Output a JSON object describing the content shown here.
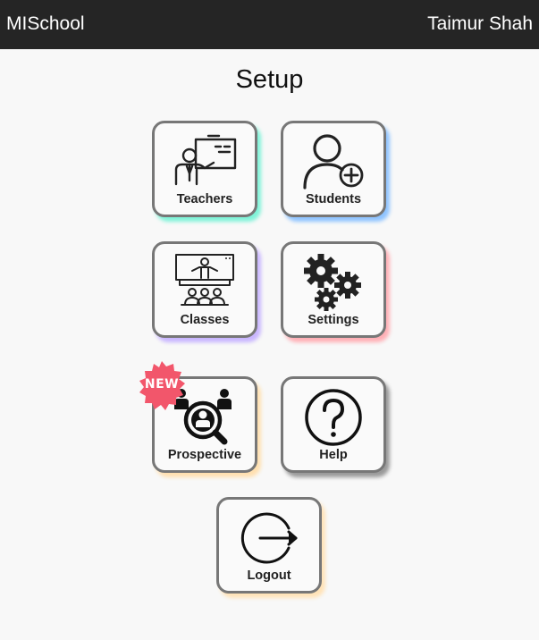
{
  "header": {
    "brand": "MISchool",
    "user": "Taimur Shah"
  },
  "page": {
    "title": "Setup"
  },
  "tiles": {
    "teachers": {
      "label": "Teachers",
      "icon": "teacher-icon",
      "shadow": "#7ff3d8"
    },
    "students": {
      "label": "Students",
      "icon": "add-user-icon",
      "shadow": "#8fc4ff"
    },
    "classes": {
      "label": "Classes",
      "icon": "classroom-icon",
      "shadow": "#c9b6ff"
    },
    "settings": {
      "label": "Settings",
      "icon": "gears-icon",
      "shadow": "#ffb0b6"
    },
    "prospective": {
      "label": "Prospective",
      "icon": "prospect-search-icon",
      "shadow": "#ffe0b0",
      "badge": "NEW",
      "badge_color": "#f2566b"
    },
    "help": {
      "label": "Help",
      "icon": "help-icon",
      "shadow": "#9a9a9a"
    },
    "logout": {
      "label": "Logout",
      "icon": "logout-icon",
      "shadow": "#ffe3b8"
    }
  }
}
